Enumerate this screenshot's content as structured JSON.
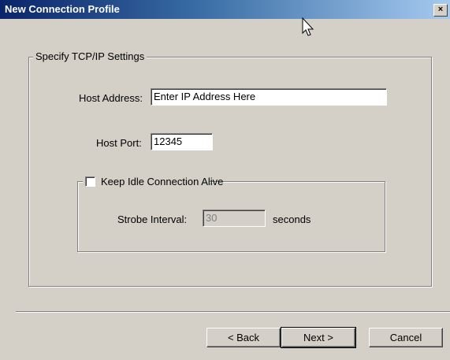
{
  "window": {
    "title": "New Connection Profile",
    "close_label": "×"
  },
  "tcpip_group": {
    "legend": "Specify TCP/IP Settings",
    "host_address_label": "Host Address:",
    "host_address_value": "Enter IP Address Here",
    "host_port_label": "Host Port:",
    "host_port_value": "12345"
  },
  "keepalive_group": {
    "checkbox_label": "Keep Idle Connection Alive",
    "checked": false,
    "strobe_label": "Strobe Interval:",
    "strobe_value": "30",
    "strobe_units": "seconds"
  },
  "buttons": {
    "back": "< Back",
    "next": "Next >",
    "cancel": "Cancel"
  },
  "colors": {
    "dialog_bg": "#d4d0c8",
    "title_start": "#0a246a",
    "title_end": "#a6caf0"
  }
}
